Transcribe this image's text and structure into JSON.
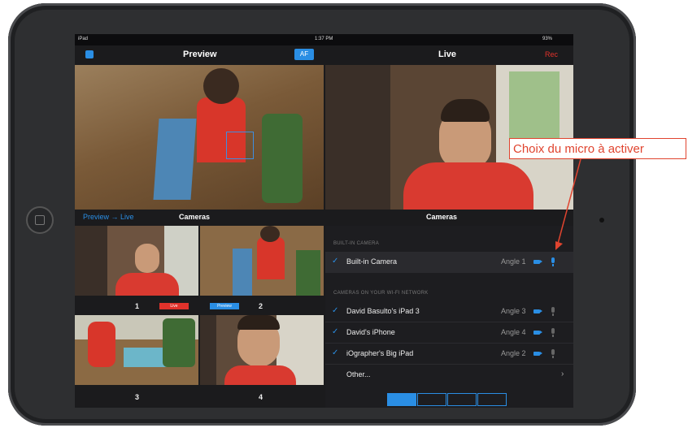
{
  "status": {
    "device": "iPad",
    "time": "1:37 PM",
    "battery": "93%"
  },
  "nav": {
    "preview_title": "Preview",
    "af_label": "AF",
    "live_title": "Live",
    "rec_label": "Rec"
  },
  "left_section": {
    "toggle_label": "Preview → Live",
    "cameras_title": "Cameras"
  },
  "tiles": [
    {
      "number": "1",
      "badge": "Live",
      "badge_color": "#e0322b"
    },
    {
      "number": "2",
      "badge": "Preview",
      "badge_color": "#2a8ee4"
    },
    {
      "number": "3"
    },
    {
      "number": "4"
    }
  ],
  "panel": {
    "title": "Cameras",
    "builtin_header": "BUILT-IN CAMERA",
    "network_header": "CAMERAS ON YOUR WI-FI NETWORK",
    "builtin": {
      "name": "Built-in Camera",
      "angle": "Angle 1",
      "checked": true,
      "mic_active": true
    },
    "network": [
      {
        "name": "David Basulto's iPad 3",
        "angle": "Angle 3",
        "checked": true,
        "mic_active": false
      },
      {
        "name": "David's iPhone",
        "angle": "Angle 4",
        "checked": true,
        "mic_active": false
      },
      {
        "name": "iOgrapher's Big iPad",
        "angle": "Angle 2",
        "checked": true,
        "mic_active": false
      }
    ],
    "other_label": "Other..."
  },
  "annotation": {
    "text": "Choix du micro à activer",
    "color": "#e0442f"
  },
  "colors": {
    "accent": "#2a8ee4",
    "rec": "#e0322b"
  }
}
